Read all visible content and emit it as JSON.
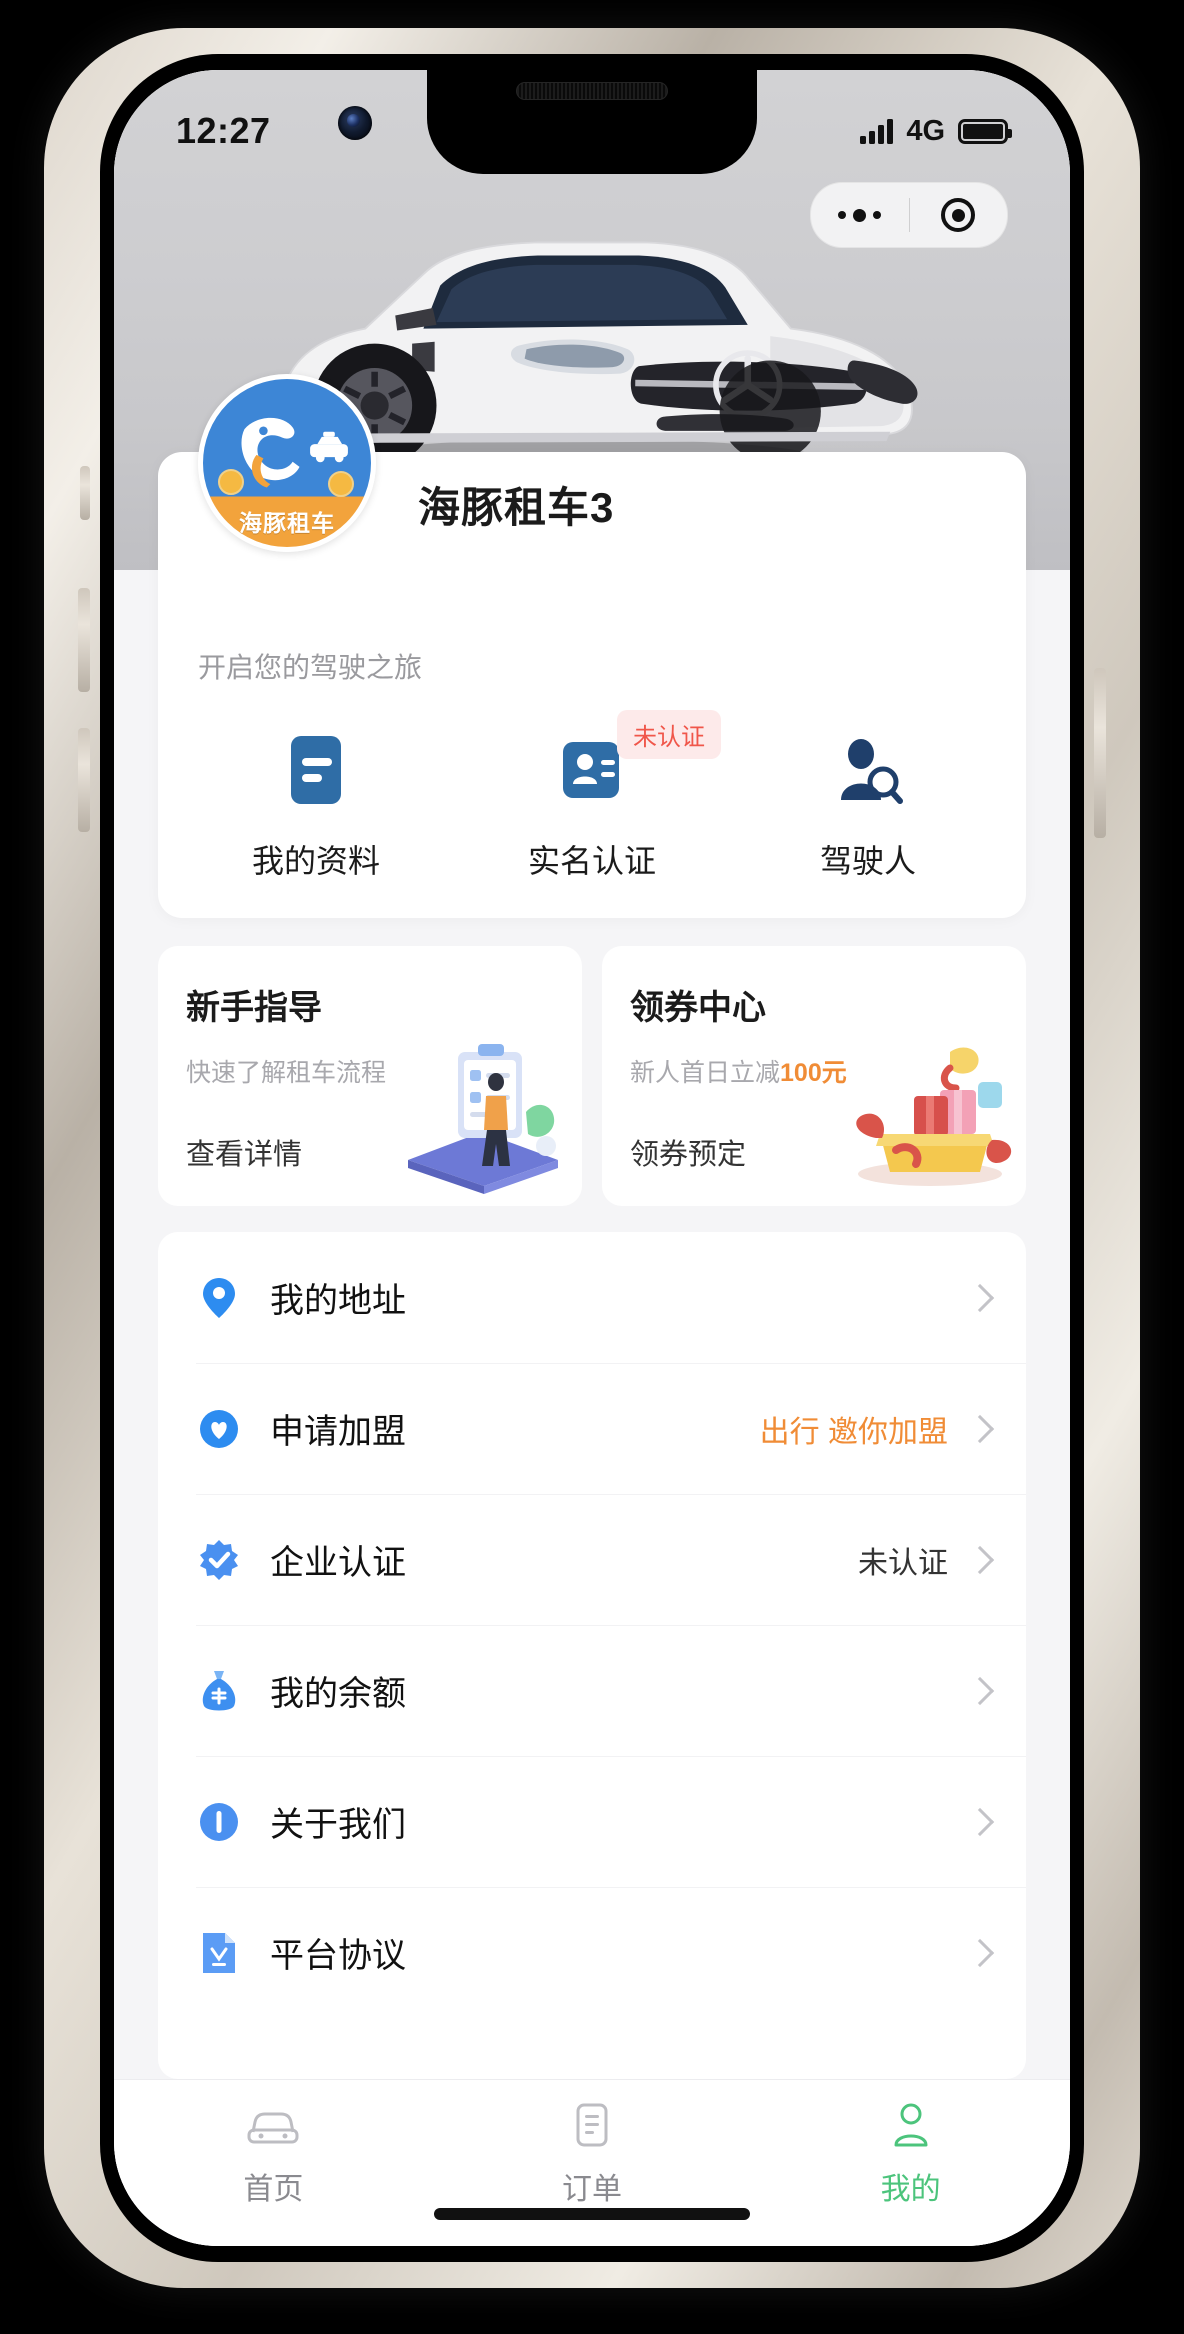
{
  "status_bar": {
    "time": "12:27",
    "network": "4G",
    "signal_icon": "signal-bars-icon",
    "battery_icon": "battery-full-icon",
    "battery_level": 100
  },
  "capsule": {
    "menu_icon": "more-dots-icon",
    "close_icon": "target-circle-icon"
  },
  "hero": {
    "image_alt": "white-sports-car-photo"
  },
  "profile": {
    "avatar_brand": "海豚租车",
    "avatar_icon": "dolphin-logo-icon",
    "name": "海豚租车3",
    "subtitle": "开启您的驾驶之旅"
  },
  "actions": [
    {
      "label": "我的资料",
      "icon": "document-lines-icon",
      "badge": ""
    },
    {
      "label": "实名认证",
      "icon": "id-card-icon",
      "badge": "未认证"
    },
    {
      "label": "驾驶人",
      "icon": "person-search-icon",
      "badge": ""
    }
  ],
  "promos": [
    {
      "title": "新手指导",
      "subtitle": "快速了解租车流程",
      "subtitle_highlight": "",
      "cta": "查看详情",
      "art": "phone-checklist-illustration"
    },
    {
      "title": "领券中心",
      "subtitle": "新人首日立减",
      "subtitle_highlight": "100元",
      "cta": "领券预定",
      "art": "gift-box-illustration"
    }
  ],
  "menu": [
    {
      "label": "我的地址",
      "icon": "location-pin-icon",
      "value": "",
      "value_accent": false
    },
    {
      "label": "申请加盟",
      "icon": "heart-badge-icon",
      "value": "出行 邀你加盟",
      "value_accent": true
    },
    {
      "label": "企业认证",
      "icon": "verified-badge-icon",
      "value": "未认证",
      "value_accent": false
    },
    {
      "label": "我的余额",
      "icon": "money-bag-icon",
      "value": "",
      "value_accent": false
    },
    {
      "label": "关于我们",
      "icon": "info-circle-icon",
      "value": "",
      "value_accent": false
    },
    {
      "label": "平台协议",
      "icon": "agreement-doc-icon",
      "value": "",
      "value_accent": false
    }
  ],
  "tabs": [
    {
      "label": "首页",
      "icon": "car-icon",
      "active": false
    },
    {
      "label": "订单",
      "icon": "order-list-icon",
      "active": false
    },
    {
      "label": "我的",
      "icon": "person-icon",
      "active": true
    }
  ],
  "colors": {
    "brand_blue": "#3d86d6",
    "icon_blue": "#2f6da6",
    "accent_orange": "#f08c36",
    "badge_red": "#f0564a",
    "tab_active_green": "#4cc47c",
    "page_bg": "#f5f5f7"
  }
}
